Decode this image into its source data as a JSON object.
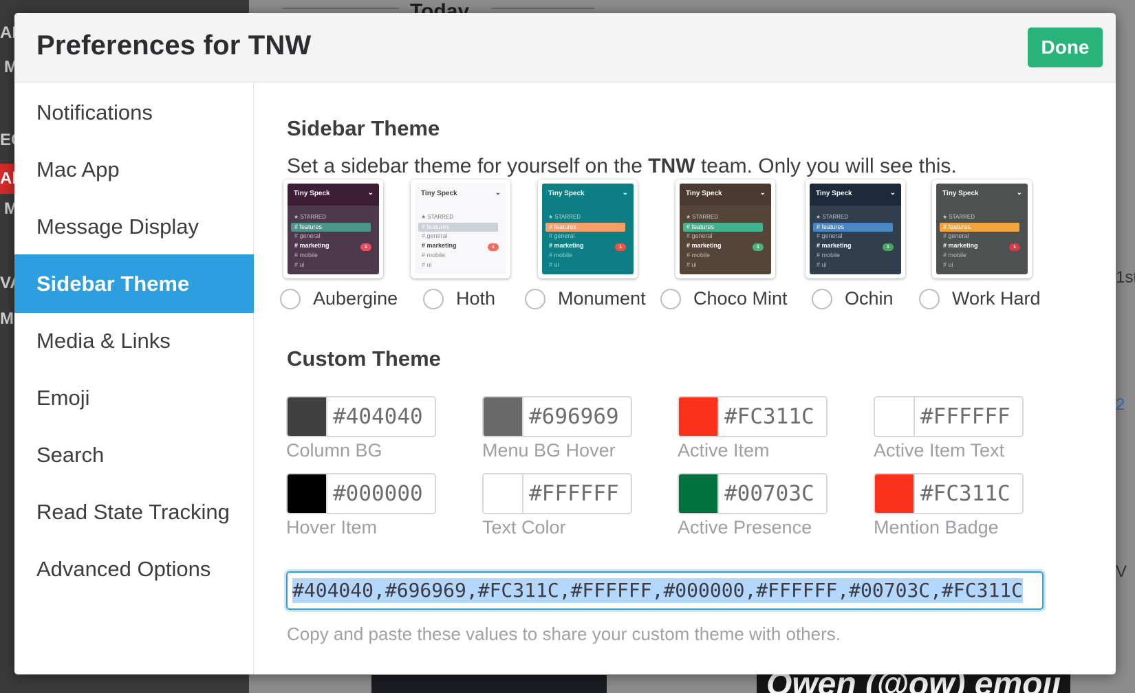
{
  "background": {
    "today_label": "Today",
    "left_fragments": [
      "AN",
      "M",
      "EC",
      "Ale",
      "M",
      "VA",
      "Mc"
    ],
    "right_fragments": [
      "1st",
      "2",
      "V"
    ],
    "bottom_text": "Owen (@ow) emoji"
  },
  "modal": {
    "title": "Preferences for TNW",
    "done_label": "Done"
  },
  "sidebar": {
    "items": [
      {
        "label": "Notifications",
        "active": false
      },
      {
        "label": "Mac App",
        "active": false
      },
      {
        "label": "Message Display",
        "active": false
      },
      {
        "label": "Sidebar Theme",
        "active": true
      },
      {
        "label": "Media & Links",
        "active": false
      },
      {
        "label": "Emoji",
        "active": false
      },
      {
        "label": "Search",
        "active": false
      },
      {
        "label": "Read State Tracking",
        "active": false
      },
      {
        "label": "Advanced Options",
        "active": false
      }
    ]
  },
  "sidebar_theme": {
    "title": "Sidebar Theme",
    "desc_prefix": "Set a sidebar theme for yourself on the ",
    "desc_team": "TNW",
    "desc_suffix": " team. Only you will see this.",
    "preview_team": "Tiny Speck",
    "preview_starred": "★ STARRED",
    "preview_channels": [
      "# features",
      "# general",
      "# marketing",
      "# mobile",
      "# ui"
    ],
    "preview_badge": "1",
    "themes": [
      {
        "name": "Aubergine",
        "head": "#3e1e34",
        "body": "#4d394b",
        "active": "#4c9689",
        "badge": "#eb4d5c",
        "text": "#ffffff"
      },
      {
        "name": "Hoth",
        "head": "#f8f8fa",
        "body": "#f8f8fa",
        "active": "#cad1d9",
        "badge": "#f16d5e",
        "text": "#444444"
      },
      {
        "name": "Monument",
        "head": "#0d7e83",
        "body": "#0d7e83",
        "active": "#f79f66",
        "badge": "#f15340",
        "text": "#ffffff"
      },
      {
        "name": "Choco Mint",
        "head": "#4a3a31",
        "body": "#544538",
        "active": "#42b38c",
        "badge": "#4fb07c",
        "text": "#ffffff"
      },
      {
        "name": "Ochin",
        "head": "#1d2a3b",
        "body": "#303e4d",
        "active": "#4a87c6",
        "badge": "#4aa564",
        "text": "#ffffff"
      },
      {
        "name": "Work Hard",
        "head": "#4d5250",
        "body": "#4d5250",
        "active": "#f3a63b",
        "badge": "#d73a49",
        "text": "#ffffff"
      }
    ]
  },
  "custom_theme": {
    "title": "Custom Theme",
    "swatches": [
      {
        "hex": "#404040",
        "label": "Column BG",
        "color": "#404040"
      },
      {
        "hex": "#696969",
        "label": "Menu BG Hover",
        "color": "#696969"
      },
      {
        "hex": "#FC311C",
        "label": "Active Item",
        "color": "#FC311C"
      },
      {
        "hex": "#FFFFFF",
        "label": "Active Item Text",
        "color": "#FFFFFF"
      },
      {
        "hex": "#000000",
        "label": "Hover Item",
        "color": "#000000"
      },
      {
        "hex": "#FFFFFF",
        "label": "Text Color",
        "color": "#FFFFFF"
      },
      {
        "hex": "#00703C",
        "label": "Active Presence",
        "color": "#00703C"
      },
      {
        "hex": "#FC311C",
        "label": "Mention Badge",
        "color": "#FC311C"
      }
    ],
    "theme_string": "#404040,#696969,#FC311C,#FFFFFF,#000000,#FFFFFF,#00703C,#FC311C",
    "help_text": "Copy and paste these values to share your custom theme with others."
  },
  "colors": {
    "accent": "#2d9ee0",
    "done": "#2ab27b"
  }
}
